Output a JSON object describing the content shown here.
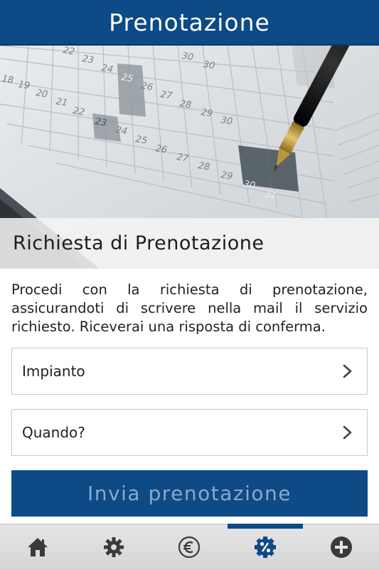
{
  "header": {
    "title": "Prenotazione"
  },
  "hero": {
    "caption": "Richiesta di Prenotazione",
    "calendar_numbers": [
      "18",
      "19",
      "20",
      "21",
      "22",
      "23",
      "24",
      "25",
      "26",
      "27",
      "28",
      "29",
      "30",
      "31",
      "21",
      "22",
      "23",
      "24",
      "25",
      "26",
      "27",
      "28",
      "29",
      "30"
    ]
  },
  "intro": {
    "text": "Procedi con la richiesta di prenotazione, assicurandoti di scrivere nella mail il servizio richiesto. Riceverai una risposta di conferma."
  },
  "form": {
    "fields": [
      {
        "label": "Impianto"
      },
      {
        "label": "Quando?"
      }
    ],
    "submit_label": "Invia prenotazione"
  },
  "tabbar": {
    "tabs": [
      {
        "icon": "home-icon",
        "active": false
      },
      {
        "icon": "gear-icon",
        "active": false
      },
      {
        "icon": "euro-icon",
        "active": false
      },
      {
        "icon": "percent-badge-icon",
        "active": true
      },
      {
        "icon": "plus-circle-icon",
        "active": false
      }
    ]
  },
  "colors": {
    "primary": "#0d4a86",
    "submit_text": "#8ea8c8",
    "tab_icon": "#3a3a3a"
  }
}
